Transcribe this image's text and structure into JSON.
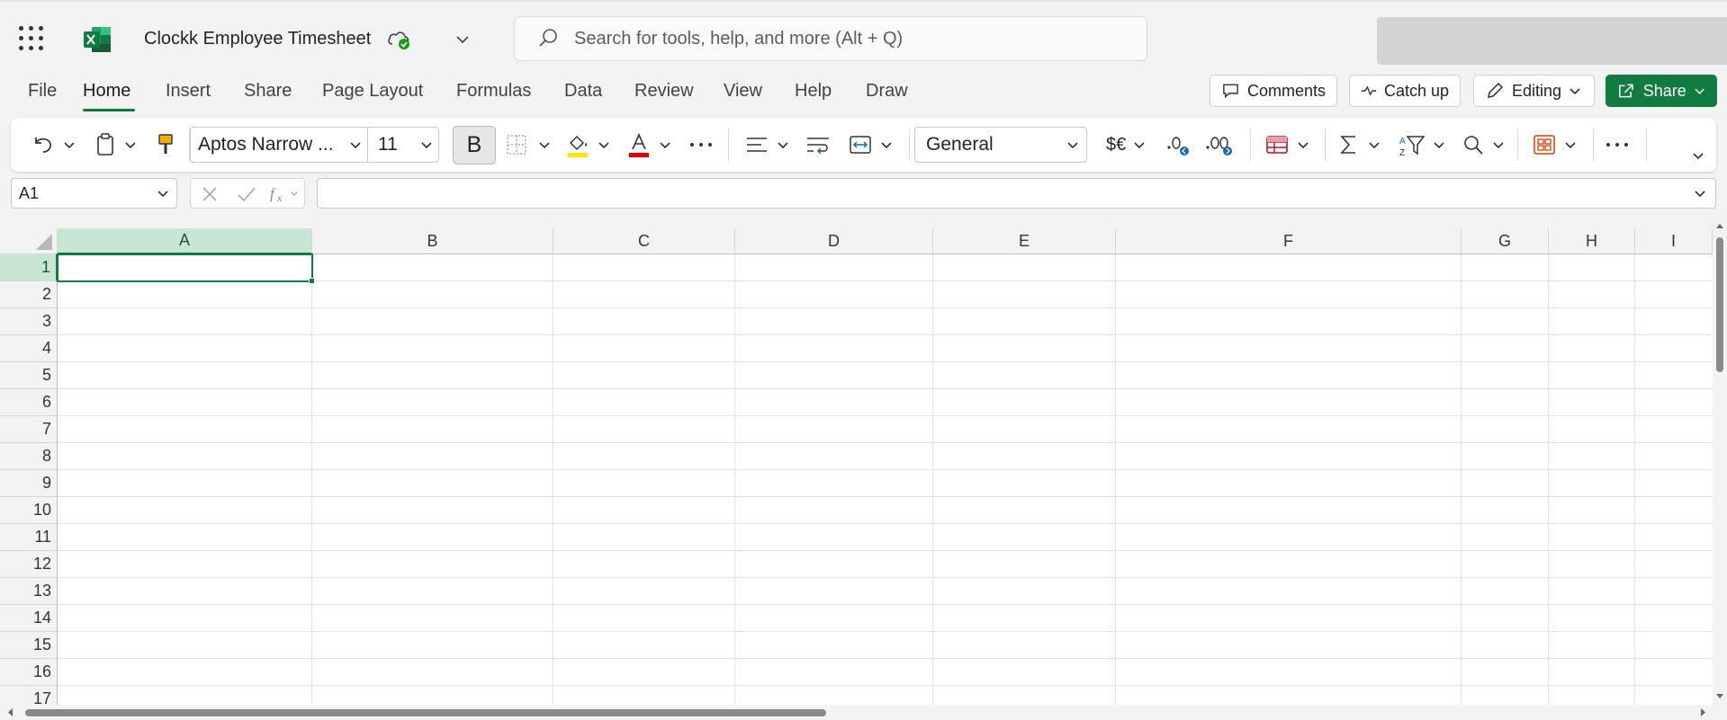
{
  "app": {
    "title": "Clockk Employee Timesheet",
    "accent": "#107c41"
  },
  "search": {
    "placeholder": "Search for tools, help, and more (Alt + Q)"
  },
  "menu": {
    "tabs": [
      "File",
      "Home",
      "Insert",
      "Share",
      "Page Layout",
      "Formulas",
      "Data",
      "Review",
      "View",
      "Help",
      "Draw"
    ],
    "active": "Home"
  },
  "top_actions": {
    "comments": "Comments",
    "catch_up": "Catch up",
    "editing": "Editing",
    "share": "Share"
  },
  "ribbon": {
    "font_name": "Aptos Narrow ...",
    "font_size": "11",
    "bold": "B",
    "number_format": "General",
    "currency": "$€",
    "icons": [
      "undo-icon",
      "clipboard-icon",
      "format-painter-icon",
      "borders-icon",
      "fill-color-icon",
      "font-color-icon",
      "more-icon",
      "align-icon",
      "wrap-text-icon",
      "merge-icon",
      "increase-decimal-icon",
      "decrease-decimal-icon",
      "insert-table-icon",
      "autosum-icon",
      "sort-filter-icon",
      "find-icon",
      "styles-icon"
    ]
  },
  "formula_bar": {
    "name_box": "A1",
    "formula": ""
  },
  "sheet": {
    "columns": [
      "A",
      "B",
      "C",
      "D",
      "E",
      "F",
      "G",
      "H",
      "I"
    ],
    "rows": [
      "1",
      "2",
      "3",
      "4",
      "5",
      "6",
      "7",
      "8",
      "9",
      "10",
      "11",
      "12",
      "13",
      "14",
      "15",
      "16",
      "17"
    ],
    "selected_cell": "A1",
    "selected_column": "A",
    "selected_row": "1"
  }
}
